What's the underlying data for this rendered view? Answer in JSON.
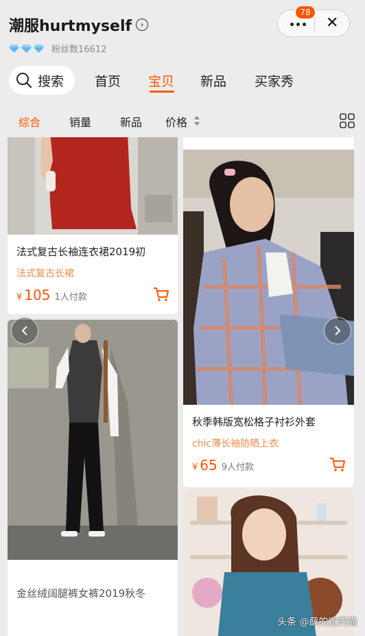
{
  "shop": {
    "name": "潮服hurtmyself",
    "fans_label": "粉丝数16612"
  },
  "capsule": {
    "badge_count": "78"
  },
  "nav": {
    "search_label": "搜索",
    "tabs": [
      "首页",
      "宝贝",
      "新品",
      "买家秀"
    ]
  },
  "sort": {
    "items": [
      "综合",
      "销量",
      "新品",
      "价格"
    ]
  },
  "products": [
    {
      "title": "法式复古长袖连衣裙2019初",
      "subtitle": "法式复古长裙",
      "currency": "¥",
      "price": "105",
      "sold": "1人付款"
    },
    {
      "title": "秋季韩版宽松格子衬衫外套",
      "subtitle": "chic薄长袖防晒上衣",
      "currency": "¥",
      "price": "65",
      "sold": "9人付款"
    },
    {
      "title": "金丝绒阔腿裤女裤2019秋冬",
      "subtitle": "",
      "currency": "",
      "price": "",
      "sold": ""
    }
  ],
  "watermark": "头条 @薛的定的猫",
  "colors": {
    "accent": "#ff5500",
    "subtitle": "#f08a4a",
    "background": "#ececec"
  }
}
